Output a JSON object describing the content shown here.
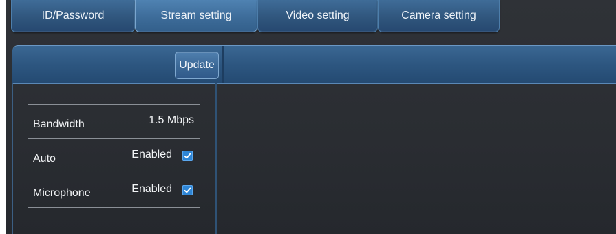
{
  "tabs": [
    {
      "label": "ID/Password",
      "active": false
    },
    {
      "label": "Stream setting",
      "active": true
    },
    {
      "label": "Video setting",
      "active": false
    },
    {
      "label": "Camera setting",
      "active": false
    }
  ],
  "toolbar": {
    "update_label": "Update"
  },
  "settings": [
    {
      "label": "Bandwidth",
      "value": "1.5 Mbps",
      "checked": null
    },
    {
      "label": "Auto",
      "value": "Enabled",
      "checked": true
    },
    {
      "label": "Microphone",
      "value": "Enabled",
      "checked": true
    }
  ],
  "colors": {
    "background": "#2c2f34",
    "accent_blue": "#3a6792",
    "checkbox": "#2f86d6",
    "text": "#f2f4f6"
  },
  "icons": {
    "checkbox_icon": "check-icon"
  }
}
